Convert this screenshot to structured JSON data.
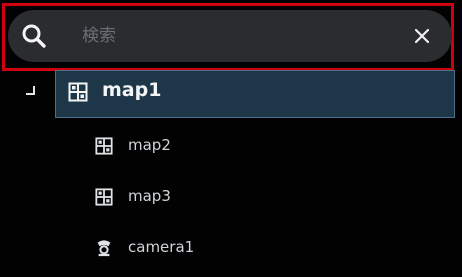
{
  "search": {
    "placeholder": "検索",
    "value": ""
  },
  "tree": {
    "root": {
      "label": "map1",
      "icon": "map-icon",
      "expanded": true,
      "selected": true
    },
    "children": [
      {
        "label": "map2",
        "icon": "map-icon"
      },
      {
        "label": "map3",
        "icon": "map-icon"
      },
      {
        "label": "camera1",
        "icon": "camera-icon"
      }
    ]
  },
  "colors": {
    "highlight_frame": "#d0000e",
    "selected_row_bg": "#1d3648",
    "search_bg": "#2a2c30"
  }
}
